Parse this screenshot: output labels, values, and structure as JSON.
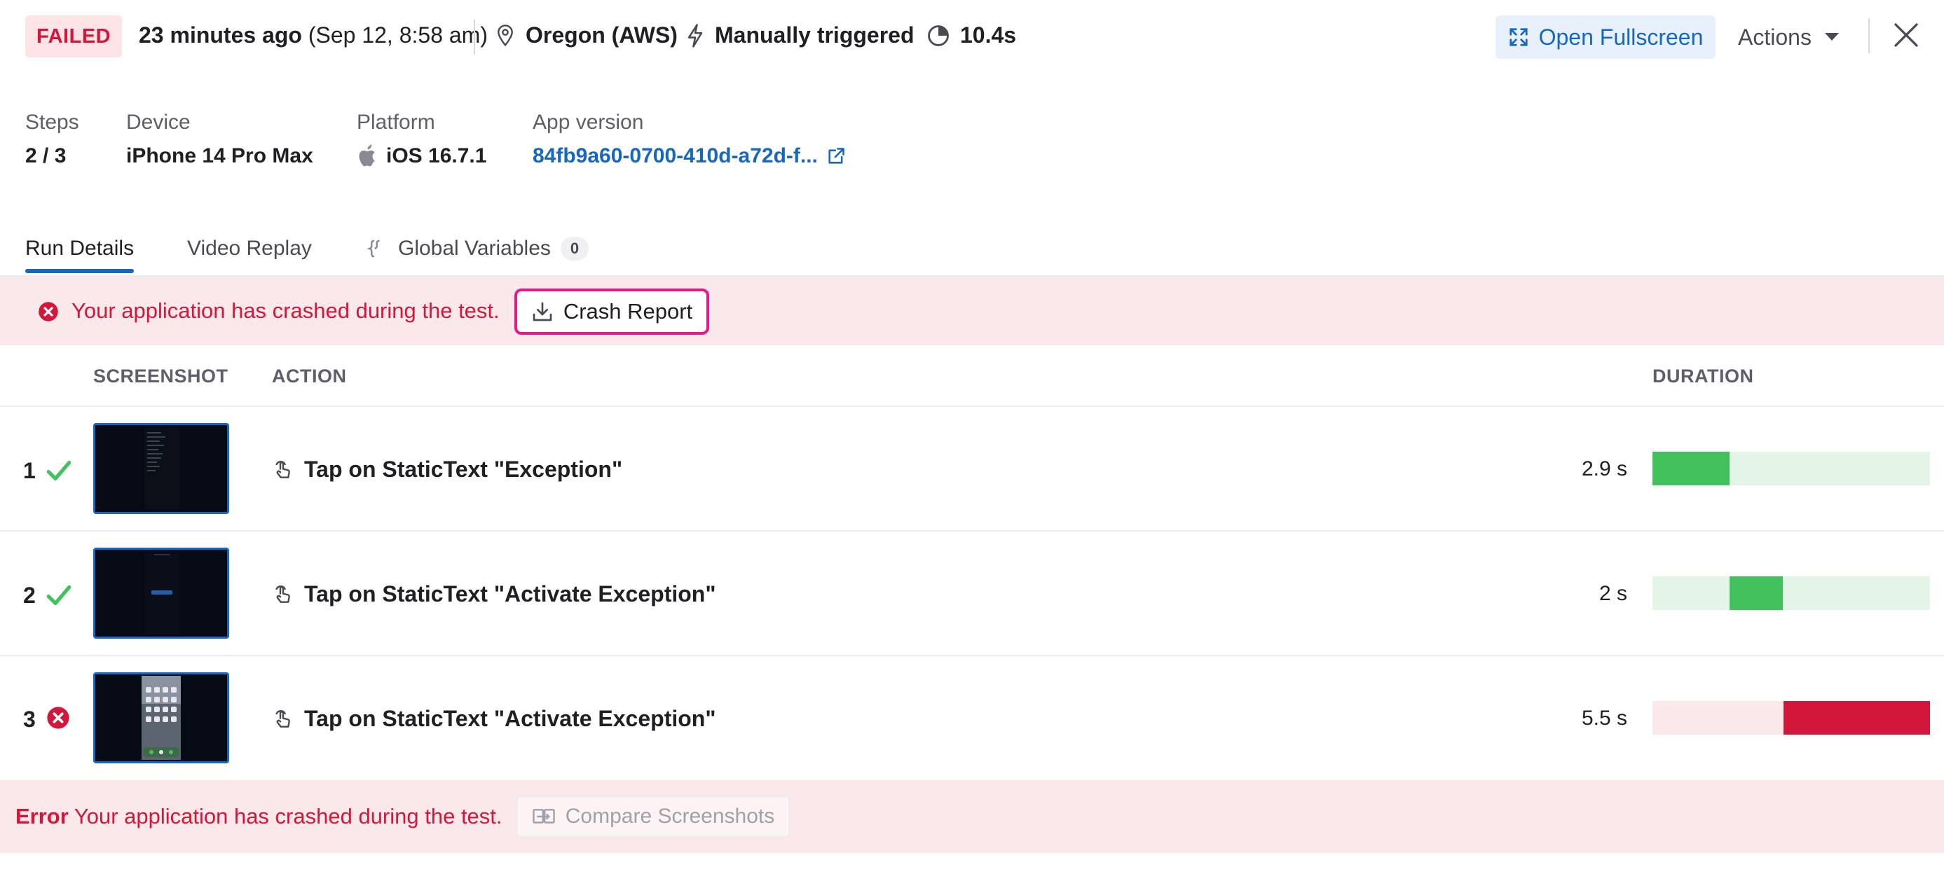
{
  "header": {
    "status": "FAILED",
    "time_ago": "23 minutes ago",
    "time_exact": "(Sep 12, 8:58 am)",
    "location": "Oregon (AWS)",
    "trigger": "Manually triggered",
    "duration": "10.4s",
    "open_fullscreen_label": "Open Fullscreen",
    "actions_label": "Actions"
  },
  "meta": {
    "steps_label": "Steps",
    "steps_value": "2 / 3",
    "device_label": "Device",
    "device_value": "iPhone 14 Pro Max",
    "platform_label": "Platform",
    "platform_value": "iOS 16.7.1",
    "app_version_label": "App version",
    "app_version_value": "84fb9a60-0700-410d-a72d-f..."
  },
  "tabs": [
    {
      "label": "Run Details",
      "active": true
    },
    {
      "label": "Video Replay",
      "active": false
    },
    {
      "label": "Global Variables",
      "count": "0",
      "active": false
    }
  ],
  "crash_banner": {
    "message": "Your application has crashed during the test.",
    "button_label": "Crash Report"
  },
  "table": {
    "columns": {
      "screenshot": "SCREENSHOT",
      "action": "ACTION",
      "duration": "DURATION"
    },
    "rows": [
      {
        "num": "1",
        "status": "passed",
        "action": "Tap on StaticText \"Exception\"",
        "duration": "2.9 s",
        "bar_start_fraction": 0.0,
        "bar_length_fraction": 0.279
      },
      {
        "num": "2",
        "status": "passed",
        "action": "Tap on StaticText \"Activate Exception\"",
        "duration": "2 s",
        "bar_start_fraction": 0.279,
        "bar_length_fraction": 0.192
      },
      {
        "num": "3",
        "status": "failed",
        "action": "Tap on StaticText \"Activate Exception\"",
        "duration": "5.5 s",
        "bar_start_fraction": 0.471,
        "bar_length_fraction": 0.529
      }
    ]
  },
  "error_bar": {
    "label": "Error",
    "message": "Your application has crashed during the test.",
    "compare_label": "Compare Screenshots"
  },
  "colors": {
    "failed_red": "#d3173a",
    "pass_green": "#43c15d",
    "pass_track": "#e3f5e6",
    "fail_track": "#fbe8ea",
    "link_blue": "#1667c1",
    "highlight_pink": "#e5198a"
  }
}
